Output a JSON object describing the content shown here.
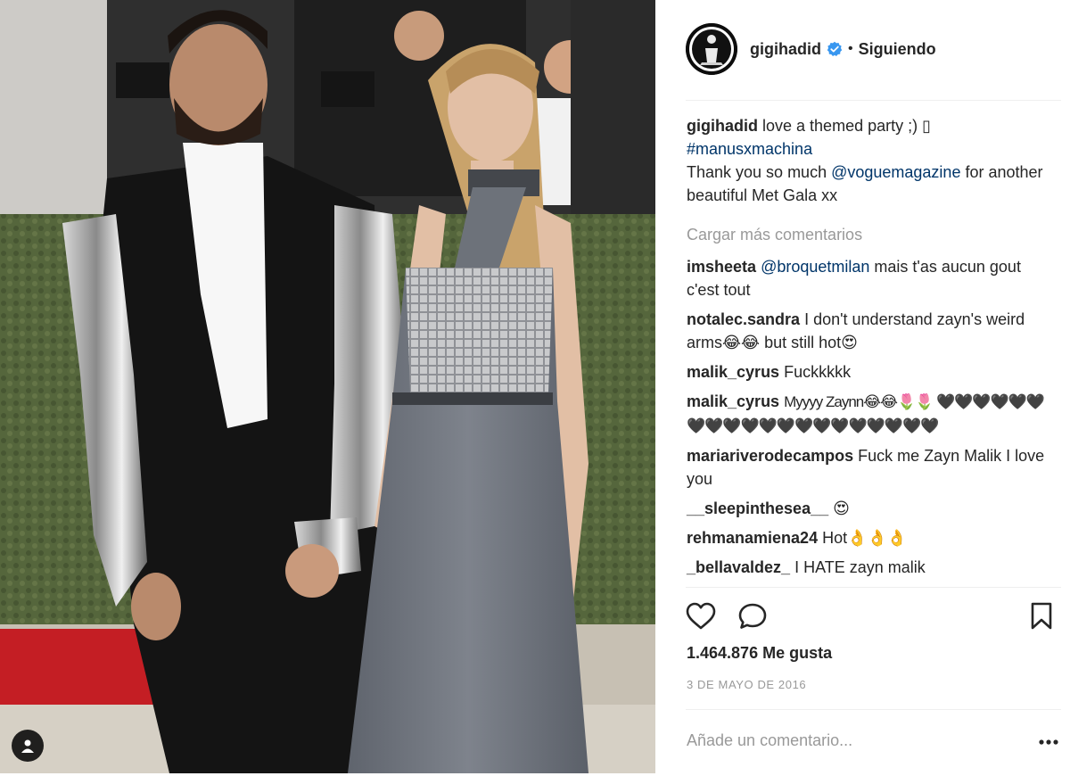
{
  "post": {
    "username": "gigihadid",
    "separator": "•",
    "follow_status": "Siguiendo",
    "caption": {
      "username": "gigihadid",
      "text_1": "love a themed party ;) ",
      "glyph": "▯",
      "hashtag": "#manusxmachina",
      "text_2": "Thank you so much ",
      "mention": "@voguemagazine",
      "text_3": " for another beautiful Met Gala xx"
    },
    "load_more_label": "Cargar más comentarios",
    "comments": [
      {
        "user": "imsheeta",
        "mention": "@broquetmilan",
        "text": " mais t'as aucun gout c'est tout"
      },
      {
        "user": "notalec.sandra",
        "mention": "",
        "text": "I don't understand zayn's weird arms😂😂 but still hot😍"
      },
      {
        "user": "malik_cyrus",
        "mention": "",
        "text": "Fuckkkkk"
      },
      {
        "user": "malik_cyrus",
        "mention": "",
        "text": "Myyyy Zaynn😂😂🌷🌷 🖤🖤🖤🖤🖤🖤🖤🖤🖤🖤🖤🖤🖤🖤🖤🖤🖤🖤🖤🖤"
      },
      {
        "user": "mariariverodecampos",
        "mention": "",
        "text": "Fuck me Zayn Malik I love you"
      },
      {
        "user": "__sleepinthesea__",
        "mention": "",
        "text": " 😍"
      },
      {
        "user": "rehmanamiena24",
        "mention": "",
        "text": "Hot👌👌👌"
      },
      {
        "user": "_bellavaldez_",
        "mention": "",
        "text": "I HATE zayn malik"
      }
    ],
    "likes_label": "1.464.876 Me gusta",
    "date_label": "3 DE MAYO DE 2016",
    "add_comment_placeholder": "Añade un comentario...",
    "more_label": "•••"
  },
  "icons": {
    "verified": "verified-badge-icon",
    "like": "heart-icon",
    "comment": "speech-bubble-icon",
    "save": "bookmark-icon",
    "tag": "user-tag-icon"
  },
  "colors": {
    "text": "#262626",
    "link": "#003569",
    "muted": "#999999",
    "verified_blue": "#3897f0",
    "divider": "#efefef"
  }
}
